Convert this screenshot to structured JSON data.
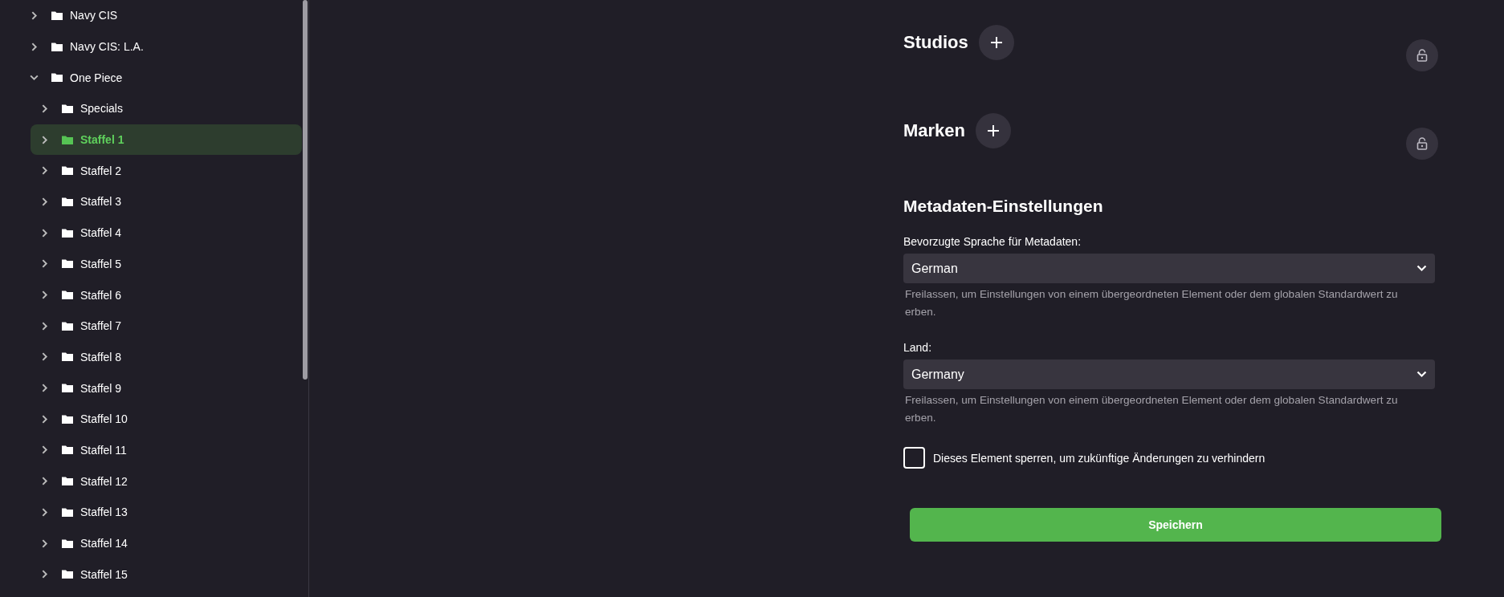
{
  "sidebar": {
    "tree": [
      {
        "label": "Navy CIS",
        "expanded": false,
        "selected": false
      },
      {
        "label": "Navy CIS: L.A.",
        "expanded": false,
        "selected": false
      },
      {
        "label": "One Piece",
        "expanded": true,
        "selected": false,
        "children": [
          {
            "label": "Specials",
            "expanded": false,
            "selected": false
          },
          {
            "label": "Staffel 1",
            "expanded": false,
            "selected": true
          },
          {
            "label": "Staffel 2",
            "expanded": false,
            "selected": false
          },
          {
            "label": "Staffel 3",
            "expanded": false,
            "selected": false
          },
          {
            "label": "Staffel 4",
            "expanded": false,
            "selected": false
          },
          {
            "label": "Staffel 5",
            "expanded": false,
            "selected": false
          },
          {
            "label": "Staffel 6",
            "expanded": false,
            "selected": false
          },
          {
            "label": "Staffel 7",
            "expanded": false,
            "selected": false
          },
          {
            "label": "Staffel 8",
            "expanded": false,
            "selected": false
          },
          {
            "label": "Staffel 9",
            "expanded": false,
            "selected": false
          },
          {
            "label": "Staffel 10",
            "expanded": false,
            "selected": false
          },
          {
            "label": "Staffel 11",
            "expanded": false,
            "selected": false
          },
          {
            "label": "Staffel 12",
            "expanded": false,
            "selected": false
          },
          {
            "label": "Staffel 13",
            "expanded": false,
            "selected": false
          },
          {
            "label": "Staffel 14",
            "expanded": false,
            "selected": false
          },
          {
            "label": "Staffel 15",
            "expanded": false,
            "selected": false
          }
        ]
      }
    ]
  },
  "sections": [
    {
      "title": "Studios"
    },
    {
      "title": "Marken"
    }
  ],
  "metadata_settings": {
    "title": "Metadaten-Einstellungen",
    "fields": [
      {
        "label": "Bevorzugte Sprache für Metadaten:",
        "value": "German",
        "help": "Freilassen, um Einstellungen von einem übergeordneten Element oder dem globalen Standardwert zu erben."
      },
      {
        "label": "Land:",
        "value": "Germany",
        "help": "Freilassen, um Einstellungen von einem übergeordneten Element oder dem globalen Standardwert zu erben."
      }
    ],
    "lock_checkbox": {
      "label": "Dieses Element sperren, um zukünftige Änderungen zu verhindern",
      "checked": false
    },
    "save_button": "Speichern"
  }
}
